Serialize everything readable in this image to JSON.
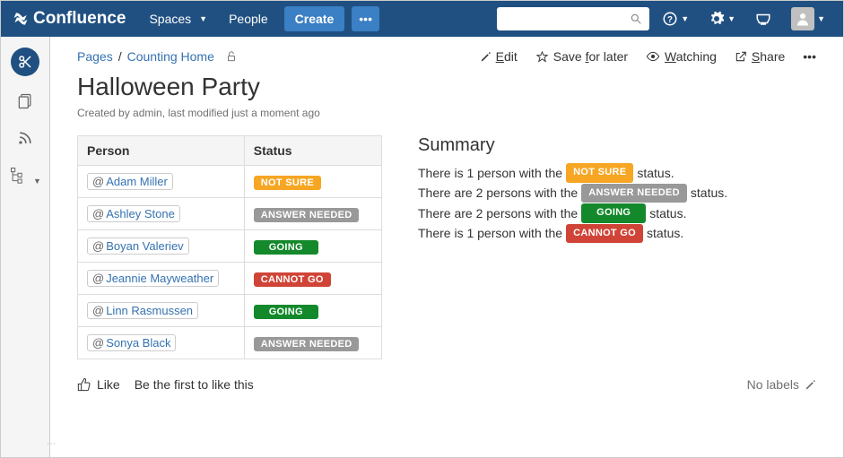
{
  "app": {
    "name": "Confluence"
  },
  "nav": {
    "spaces": "Spaces",
    "people": "People",
    "create": "Create"
  },
  "breadcrumb": {
    "root": "Pages",
    "parent": "Counting Home"
  },
  "actions": {
    "edit": "Edit",
    "save": "Save for later",
    "watching": "Watching",
    "share": "Share"
  },
  "page": {
    "title": "Halloween Party",
    "meta": "Created by admin, last modified just a moment ago"
  },
  "table": {
    "headers": {
      "person": "Person",
      "status": "Status"
    },
    "rows": [
      {
        "name": "Adam Miller",
        "status": "NOT SURE",
        "cls": "orange"
      },
      {
        "name": "Ashley Stone",
        "status": "ANSWER NEEDED",
        "cls": "gray"
      },
      {
        "name": "Boyan Valeriev",
        "status": "GOING",
        "cls": "green"
      },
      {
        "name": "Jeannie Mayweather",
        "status": "CANNOT GO",
        "cls": "red"
      },
      {
        "name": "Linn Rasmussen",
        "status": "GOING",
        "cls": "green"
      },
      {
        "name": "Sonya Black",
        "status": "ANSWER NEEDED",
        "cls": "gray"
      }
    ]
  },
  "summary": {
    "heading": "Summary",
    "lines": [
      {
        "pre": "There is 1 person with the",
        "label": "NOT SURE",
        "cls": "orange",
        "post": "status."
      },
      {
        "pre": "There are 2 persons with the",
        "label": "ANSWER NEEDED",
        "cls": "gray",
        "post": "status."
      },
      {
        "pre": "There are 2 persons with the",
        "label": "GOING",
        "cls": "green",
        "post": "status."
      },
      {
        "pre": "There is 1 person with the",
        "label": "CANNOT GO",
        "cls": "red",
        "post": "status."
      }
    ]
  },
  "footer": {
    "like": "Like",
    "like_prompt": "Be the first to like this",
    "no_labels": "No labels"
  }
}
